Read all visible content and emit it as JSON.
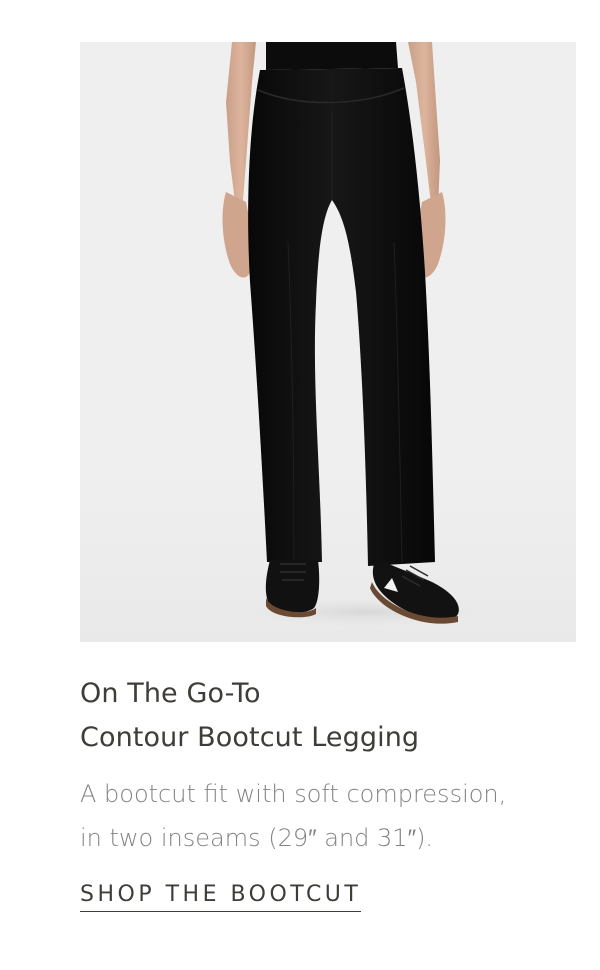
{
  "product": {
    "image_alt": "Model wearing black contour bootcut leggings with black sneakers",
    "title_line1": "On The Go-To",
    "title_line2": "Contour Bootcut Legging",
    "description_line1": "A bootcut fit with soft compression,",
    "description_line2": "in two inseams (29″ and 31″).",
    "cta_label": "SHOP THE BOOTCUT"
  },
  "colors": {
    "background": "#ffffff",
    "image_background": "#efefef",
    "title": "#3f3d38",
    "description": "#838383",
    "cta": "#3f3d38",
    "product": "#0b0b0b"
  }
}
